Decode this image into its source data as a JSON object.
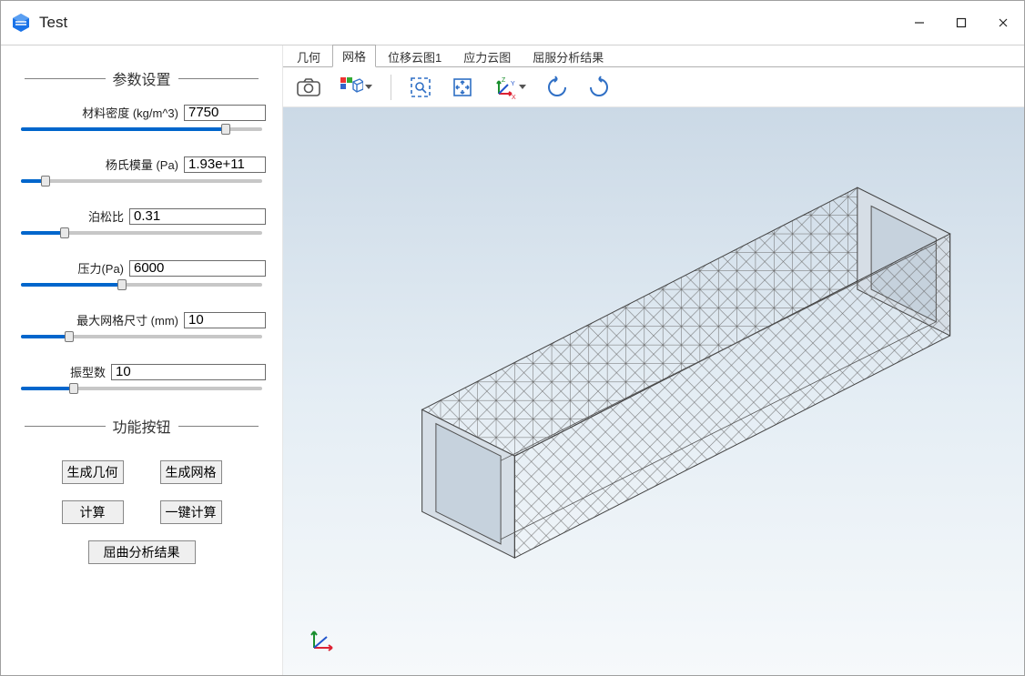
{
  "window": {
    "title": "Test"
  },
  "sidebar": {
    "section_params": "参数设置",
    "section_func": "功能按钮",
    "params": {
      "density": {
        "label": "材料密度 (kg/m^3)",
        "value": "7750",
        "pct": 85
      },
      "youngs": {
        "label": "杨氏模量 (Pa)",
        "value": "1.93e+11",
        "pct": 10
      },
      "poisson": {
        "label": "泊松比",
        "value": "0.31",
        "pct": 18
      },
      "pressure": {
        "label": "压力(Pa)",
        "value": "6000",
        "pct": 42
      },
      "mesh": {
        "label": "最大网格尺寸 (mm)",
        "value": "10",
        "pct": 20
      },
      "modes": {
        "label": "振型数",
        "value": "10",
        "pct": 22
      }
    },
    "buttons": {
      "gen_geom": "生成几何",
      "gen_mesh": "生成网格",
      "compute": "计算",
      "one_click": "一键计算",
      "buckling": "屈曲分析结果"
    }
  },
  "tabs": [
    {
      "key": "geom",
      "label": "几何",
      "active": false
    },
    {
      "key": "mesh",
      "label": "网格",
      "active": true
    },
    {
      "key": "disp",
      "label": "位移云图1",
      "active": false
    },
    {
      "key": "stress",
      "label": "应力云图",
      "active": false
    },
    {
      "key": "buckle",
      "label": "屈服分析结果",
      "active": false
    }
  ],
  "toolbar_icons": {
    "screenshot": "camera-icon",
    "view_mode": "cube-palette-icon",
    "zoom_box": "zoom-selection-icon",
    "fit": "fit-view-icon",
    "axes": "axes-icon",
    "rotate_cw": "rotate-cw-icon",
    "rotate_ccw": "rotate-ccw-icon"
  }
}
